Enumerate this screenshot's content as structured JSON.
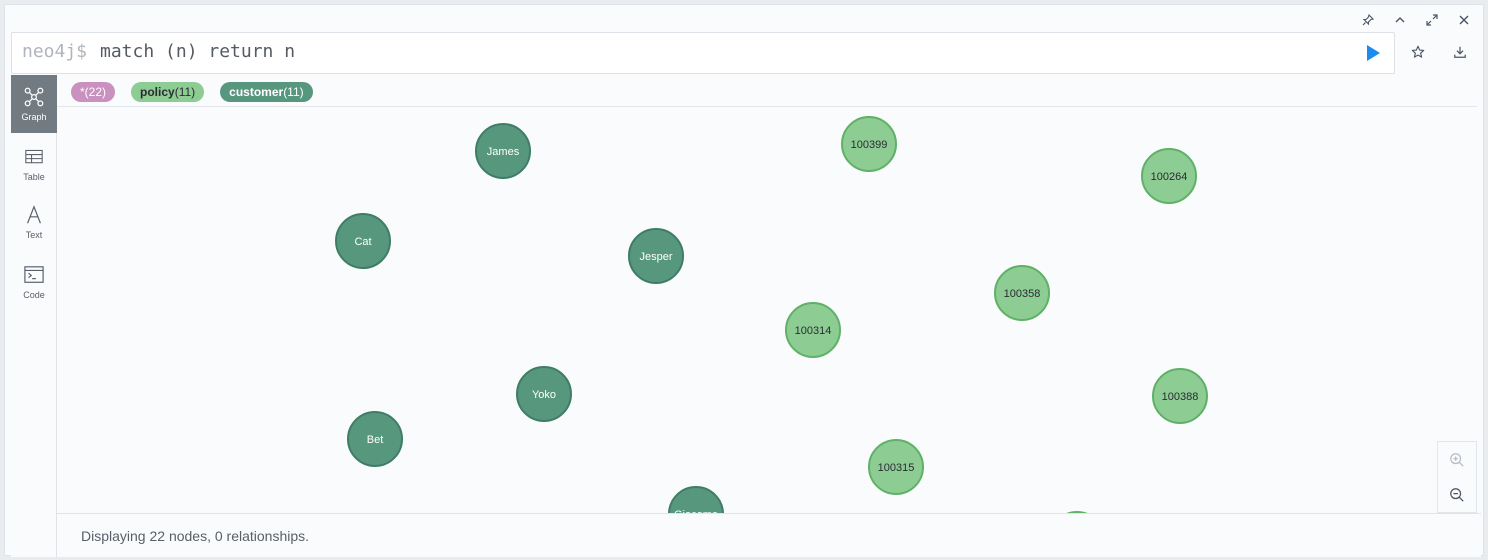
{
  "editor": {
    "prompt": "neo4j$",
    "query": "match (n) return n"
  },
  "window_controls": [
    "pin-icon",
    "collapse-icon",
    "expand-icon",
    "close-icon"
  ],
  "side_controls": [
    "star-icon",
    "download-icon"
  ],
  "tabs": [
    {
      "label": "Graph",
      "icon": "graph-icon",
      "active": true
    },
    {
      "label": "Table",
      "icon": "table-icon",
      "active": false
    },
    {
      "label": "Text",
      "icon": "text-icon",
      "active": false
    },
    {
      "label": "Code",
      "icon": "code-icon",
      "active": false
    }
  ],
  "legend": {
    "all": {
      "label": "*",
      "count": "(22)",
      "color": "#c990c0"
    },
    "policy": {
      "label": "policy",
      "count": "(11)",
      "color": "#8dcc93"
    },
    "customer": {
      "label": "customer",
      "count": "(11)",
      "color": "#57977e"
    }
  },
  "nodes": [
    {
      "label": "James",
      "type": "customer"
    },
    {
      "label": "Cat",
      "type": "customer"
    },
    {
      "label": "Jesper",
      "type": "customer"
    },
    {
      "label": "Yoko",
      "type": "customer"
    },
    {
      "label": "Bet",
      "type": "customer"
    },
    {
      "label": "Giacomo",
      "type": "customer"
    },
    {
      "label": "100399",
      "type": "policy"
    },
    {
      "label": "100264",
      "type": "policy"
    },
    {
      "label": "100358",
      "type": "policy"
    },
    {
      "label": "100314",
      "type": "policy"
    },
    {
      "label": "100388",
      "type": "policy"
    },
    {
      "label": "100315",
      "type": "policy"
    },
    {
      "label": "",
      "type": "policy"
    }
  ],
  "colors": {
    "customer_fill": "#57977e",
    "customer_stroke": "#3f7d66",
    "policy_fill": "#8dcc93",
    "policy_stroke": "#5fb167",
    "run_button": "#1a8cf0"
  },
  "status": {
    "text": "Displaying 22 nodes, 0 relationships."
  }
}
